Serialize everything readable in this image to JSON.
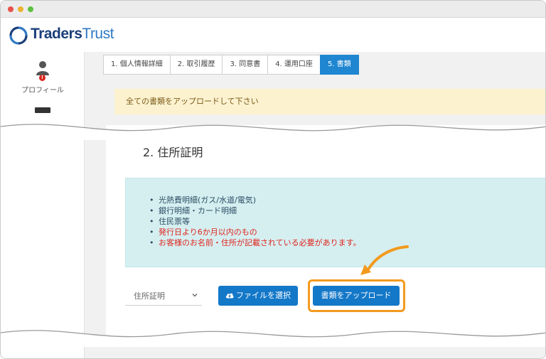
{
  "window": {
    "controls": [
      "close",
      "minimize",
      "zoom"
    ]
  },
  "brand": {
    "name_bold": "Traders",
    "name_light": "Trust",
    "logo_icon": "traderstrust-logo-icon"
  },
  "sidebar": {
    "items": [
      {
        "label": "プロフィール",
        "icon": "user-icon",
        "badge_icon": "alert-icon",
        "badge": "!"
      }
    ]
  },
  "steps": [
    {
      "label": "1.  個人情報詳細",
      "active": false
    },
    {
      "label": "2.  取引履歴",
      "active": false
    },
    {
      "label": "3.  同意書",
      "active": false
    },
    {
      "label": "4.  運用口座",
      "active": false
    },
    {
      "label": "5.  書類",
      "active": true
    }
  ],
  "notice": {
    "text": "全ての書類をアップロードして下さい"
  },
  "section": {
    "title": "2.  住所証明",
    "items": [
      {
        "text": "光熱費明細(ガス/水道/電気)",
        "warning": false
      },
      {
        "text": "銀行明細・カード明細",
        "warning": false
      },
      {
        "text": "住民票等",
        "warning": false
      },
      {
        "text": "発行日より6か月以内のもの",
        "warning": true
      },
      {
        "text": "お客様のお名前・住所が記載されている必要があります。",
        "warning": true
      }
    ]
  },
  "upload": {
    "document_type": "住所証明",
    "choose_file_label": "ファイルを選択",
    "upload_label": "書類をアップロード"
  },
  "colors": {
    "accent": "#1f86d1",
    "button": "#1478c8",
    "highlight": "#f39a1e",
    "warning": "#e0241b"
  }
}
